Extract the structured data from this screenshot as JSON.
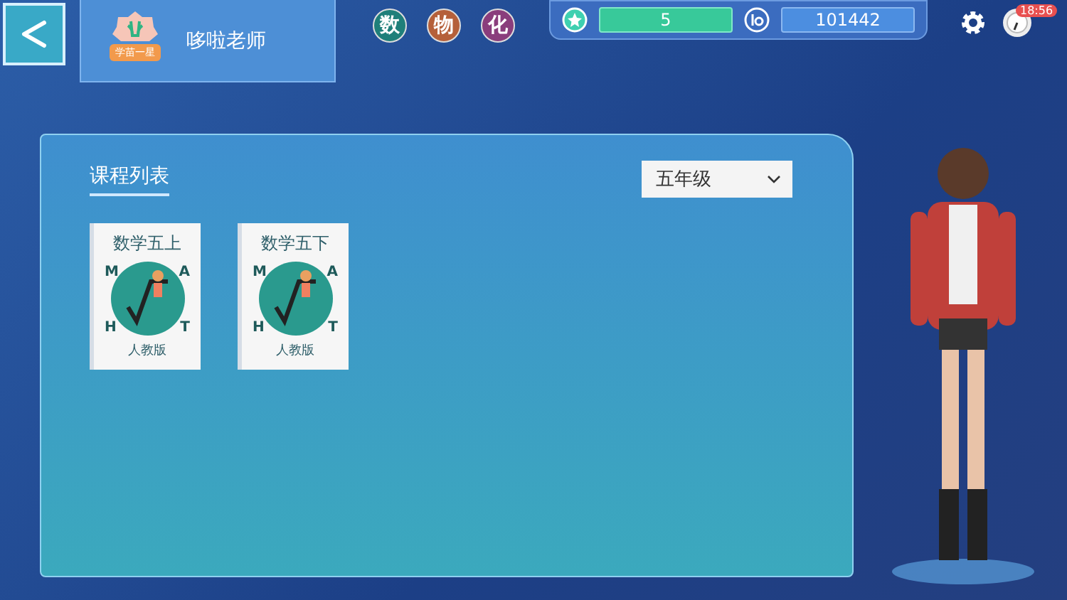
{
  "profile": {
    "badge_text": "学苗一星",
    "name": "哆啦老师"
  },
  "subjects": [
    {
      "label": "数",
      "color": "#1f7f7a"
    },
    {
      "label": "物",
      "color": "#b5603a"
    },
    {
      "label": "化",
      "color": "#8a3d7c"
    }
  ],
  "stats": {
    "stars": "5",
    "coins": "101442"
  },
  "clock": {
    "time": "18:56"
  },
  "panel": {
    "title": "课程列表",
    "grade_select": {
      "value": "五年级"
    }
  },
  "courses": [
    {
      "title": "数学五上",
      "cover_letters": [
        "M",
        "A",
        "H",
        "T"
      ],
      "edition": "人教版"
    },
    {
      "title": "数学五下",
      "cover_letters": [
        "M",
        "A",
        "H",
        "T"
      ],
      "edition": "人教版"
    }
  ]
}
